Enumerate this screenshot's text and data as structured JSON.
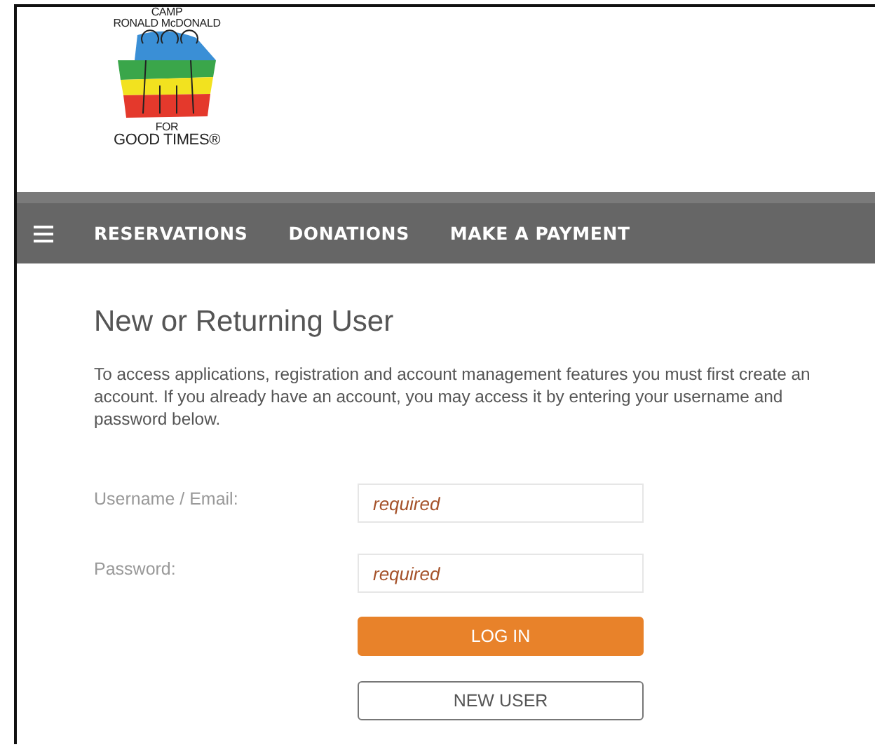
{
  "logo": {
    "top_lines": [
      "CAMP",
      "RONALD McDONALD"
    ],
    "bottom_lines": [
      "FOR",
      "GOOD TIMES®"
    ]
  },
  "nav": {
    "items": [
      "RESERVATIONS",
      "DONATIONS",
      "MAKE A PAYMENT"
    ]
  },
  "login": {
    "title": "New or Returning User",
    "intro": "To access applications, registration and account management features you must first create an account. If you already have an account, you may access it by entering your username and password below.",
    "fields": [
      {
        "label": "Username / Email:",
        "placeholder": "required"
      },
      {
        "label": "Password:",
        "placeholder": "required"
      }
    ],
    "buttons": [
      {
        "label": "LOG IN",
        "kind": "primary"
      },
      {
        "label": "NEW USER",
        "kind": "secondary"
      }
    ]
  }
}
